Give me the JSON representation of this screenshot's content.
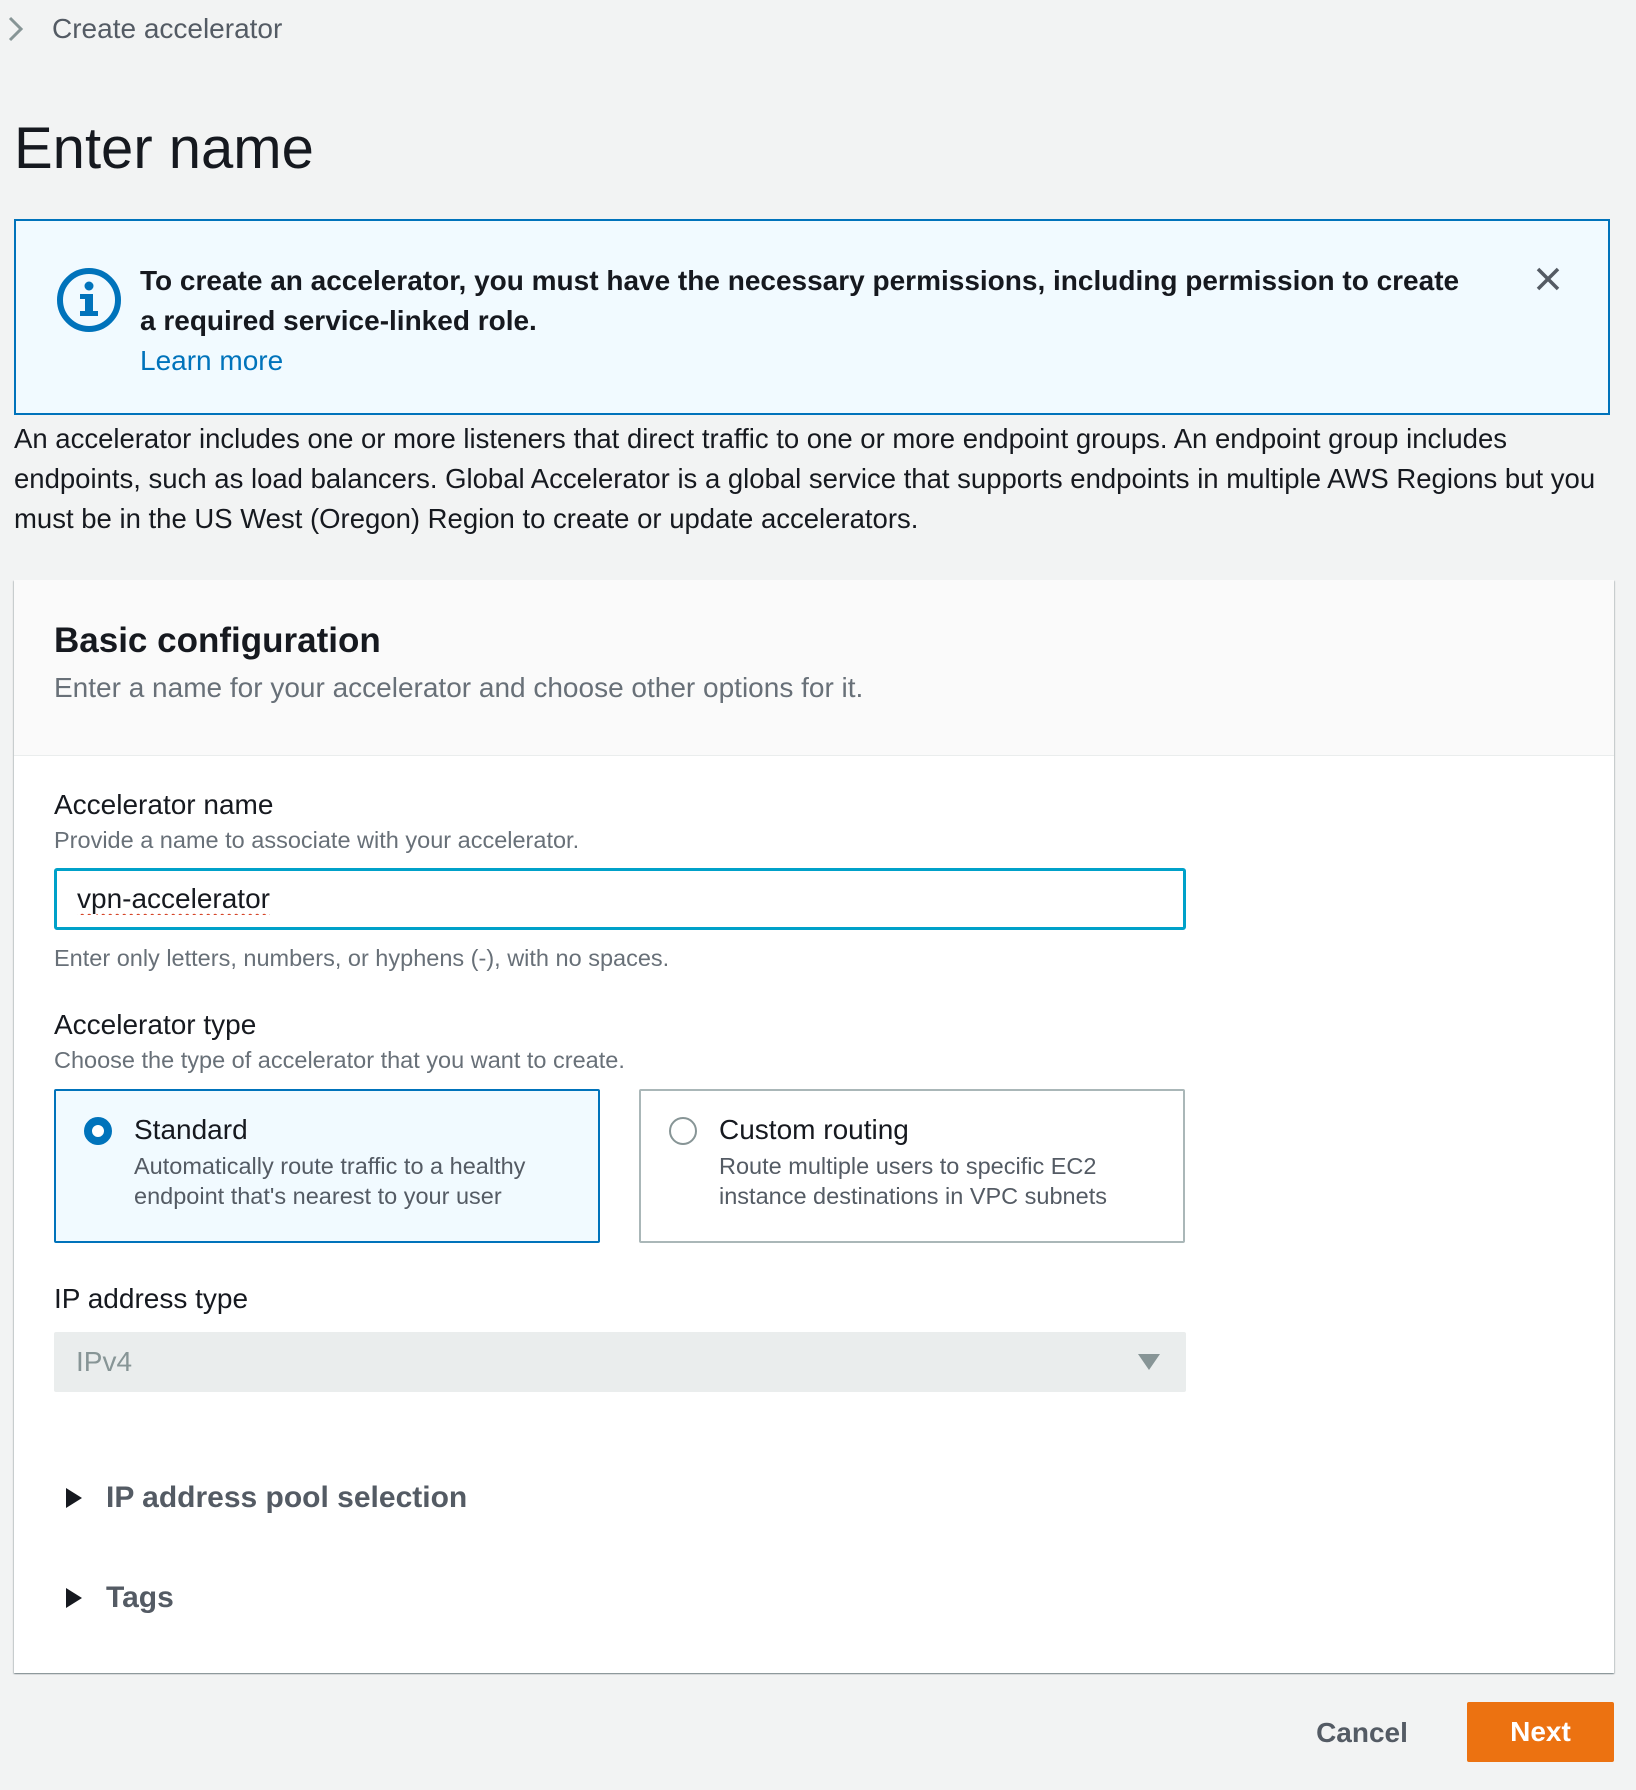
{
  "breadcrumb": {
    "current": "Create accelerator"
  },
  "page_title": "Enter name",
  "alert": {
    "type": "info",
    "message": "To create an accelerator, you must have the necessary permissions, including permission to create a required service-linked role.",
    "link_label": "Learn more",
    "icon": "info-icon",
    "close_icon": "close-icon"
  },
  "description": "An accelerator includes one or more listeners that direct traffic to one or more endpoint groups. An endpoint group includes endpoints, such as load balancers. Global Accelerator is a global service that supports endpoints in multiple AWS Regions but you must be in the US West (Oregon) Region to create or update accelerators.",
  "basic_configuration": {
    "title": "Basic configuration",
    "subtitle": "Enter a name for your accelerator and choose other options for it.",
    "accelerator_name": {
      "label": "Accelerator name",
      "description": "Provide a name to associate with your accelerator.",
      "value": "vpn-accelerator",
      "constraint": "Enter only letters, numbers, or hyphens (-), with no spaces."
    },
    "accelerator_type": {
      "label": "Accelerator type",
      "description": "Choose the type of accelerator that you want to create.",
      "options": [
        {
          "title": "Standard",
          "description": "Automatically route traffic to a healthy endpoint that's nearest to your user",
          "selected": true
        },
        {
          "title": "Custom routing",
          "description": "Route multiple users to specific EC2 instance destinations in VPC subnets",
          "selected": false
        }
      ]
    },
    "ip_address_type": {
      "label": "IP address type",
      "value": "IPv4",
      "disabled": true
    },
    "expanders": [
      {
        "label": "IP address pool selection",
        "expanded": false
      },
      {
        "label": "Tags",
        "expanded": false
      }
    ]
  },
  "footer": {
    "cancel_label": "Cancel",
    "next_label": "Next"
  },
  "colors": {
    "background": "#f2f3f3",
    "accent_blue": "#0073bb",
    "input_focus": "#00a1c9",
    "primary_button": "#ec7211",
    "alert_background": "#f1faff"
  }
}
